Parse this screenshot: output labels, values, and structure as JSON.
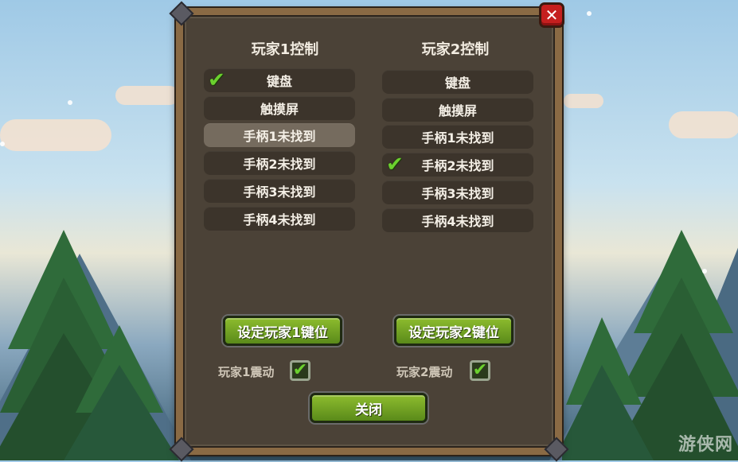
{
  "player1": {
    "title": "玩家1控制",
    "options": [
      "键盘",
      "触摸屏",
      "手柄1未找到",
      "手柄2未找到",
      "手柄3未找到",
      "手柄4未找到"
    ],
    "selected_index": 0,
    "keybind_button": "设定玩家1键位",
    "vibration_label": "玩家1震动",
    "vibration_checked": true
  },
  "player2": {
    "title": "玩家2控制",
    "options": [
      "键盘",
      "触摸屏",
      "手柄1未找到",
      "手柄2未找到",
      "手柄3未找到",
      "手柄4未找到"
    ],
    "selected_index": 3,
    "keybind_button": "设定玩家2键位",
    "vibration_label": "玩家2震动",
    "vibration_checked": true
  },
  "close_button": "关闭",
  "check_glyph": "✔",
  "close_glyph": "✕",
  "watermark": "游侠网",
  "colors": {
    "accent_green": "#6bd12e",
    "button_green": "#7aa82a",
    "close_red": "#c51f1f",
    "panel_bg": "#4b4237"
  }
}
